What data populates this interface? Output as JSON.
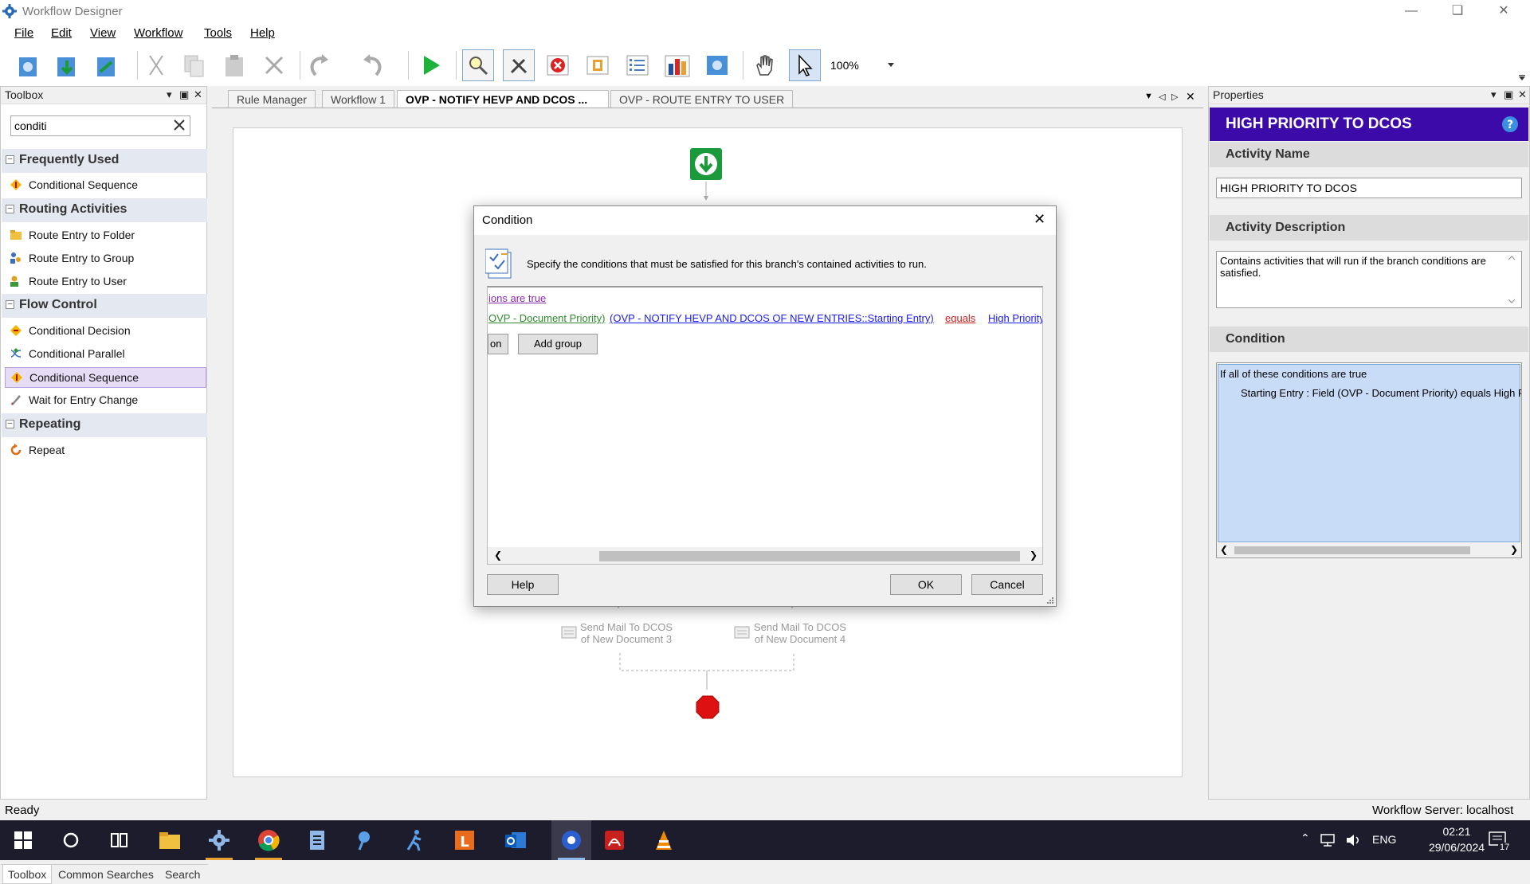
{
  "window": {
    "title": "Workflow Designer",
    "controls": [
      "minimize",
      "restore",
      "close"
    ]
  },
  "menu": {
    "items": [
      {
        "label": "File"
      },
      {
        "label": "Edit"
      },
      {
        "label": "View"
      },
      {
        "label": "Workflow"
      },
      {
        "label": "Tools"
      },
      {
        "label": "Help"
      }
    ]
  },
  "toolbar": {
    "zoom": "100%",
    "icons": [
      "new-workflow-icon",
      "import-icon",
      "publish-icon",
      "cut-icon",
      "copy-icon",
      "paste-icon",
      "delete-icon",
      "undo-icon",
      "redo-icon",
      "run-icon",
      "find-icon",
      "tools-icon",
      "stop-icon",
      "validate-icon",
      "checklist-icon",
      "report-icon",
      "settings-icon",
      "pan-hand-icon",
      "pointer-icon"
    ]
  },
  "toolbox": {
    "title": "Toolbox",
    "search": {
      "value": "conditi"
    },
    "categories": [
      {
        "name": "Frequently Used",
        "items": [
          {
            "label": "Conditional Sequence"
          }
        ]
      },
      {
        "name": "Routing Activities",
        "items": [
          {
            "label": "Route Entry to Folder"
          },
          {
            "label": "Route Entry to Group"
          },
          {
            "label": "Route Entry to User"
          }
        ]
      },
      {
        "name": "Flow Control",
        "items": [
          {
            "label": "Conditional Decision"
          },
          {
            "label": "Conditional Parallel"
          },
          {
            "label": "Conditional Sequence"
          },
          {
            "label": "Wait for Entry Change"
          }
        ]
      },
      {
        "name": "Repeating",
        "items": [
          {
            "label": "Repeat"
          }
        ]
      }
    ],
    "bottom_tabs": [
      {
        "label": "Toolbox"
      },
      {
        "label": "Common Searches"
      },
      {
        "label": "Search"
      }
    ]
  },
  "document_tabs": [
    {
      "label": "Rule Manager"
    },
    {
      "label": "Workflow 1"
    },
    {
      "label": "OVP - NOTIFY HEVP AND DCOS ..."
    },
    {
      "label": "OVP - ROUTE ENTRY TO USER"
    }
  ],
  "canvas": {
    "activities": [
      {
        "label_line1": "Send Mail To DCOS",
        "label_line2": "of New Document 3"
      },
      {
        "label_line1": "Send Mail To DCOS",
        "label_line2": "of New Document 4"
      }
    ]
  },
  "dialog": {
    "title": "Condition",
    "instruction": "Specify the conditions that must be satisfied for this branch's contained activities to run.",
    "condition_header": "ions are true",
    "rule": {
      "field": "OVP - Document Priority)",
      "entry": "(OVP - NOTIFY HEVP AND DCOS OF NEW ENTRIES::Starting Entry)",
      "operator": "equals",
      "value": "High Priority"
    },
    "add_condition_fragment": "on",
    "add_group": "Add group",
    "help": "Help",
    "ok": "OK",
    "cancel": "Cancel"
  },
  "properties": {
    "title": "Properties",
    "banner": "HIGH PRIORITY TO DCOS",
    "activity_name_label": "Activity Name",
    "activity_name": "HIGH PRIORITY TO DCOS",
    "activity_description_label": "Activity Description",
    "activity_description": "Contains activities that will run if the branch conditions are satisfied.",
    "condition_label": "Condition",
    "condition_line1": "If all of these conditions are true",
    "condition_line2": "Starting Entry : Field (OVP - Document Priority) equals High P"
  },
  "status": {
    "left": "Ready",
    "right": "Workflow Server: localhost"
  },
  "taskbar": {
    "language": "ENG",
    "time": "02:21",
    "date": "29/06/2024",
    "notification_count": "17"
  },
  "colors": {
    "banner": "#3b0aa8",
    "link_green": "#2e8b2e",
    "link_blue": "#1a1aee",
    "link_red": "#cc2222",
    "link_purple": "#8a2ab0",
    "start_green": "#1a9a3a",
    "stop_red": "#dd1111"
  }
}
